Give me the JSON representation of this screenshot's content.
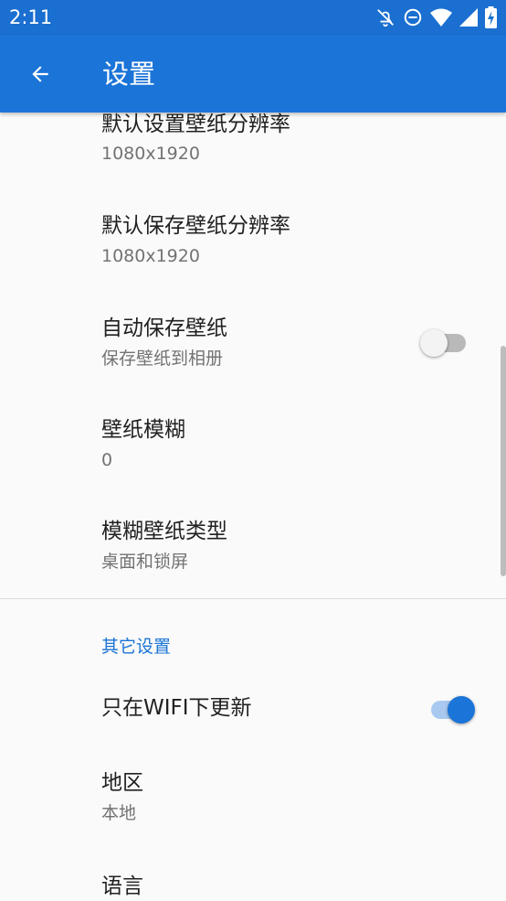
{
  "status_bar": {
    "time": "2:11",
    "icons": [
      "notifications-off-icon",
      "do-not-disturb-icon",
      "wifi-icon",
      "cell-signal-icon",
      "battery-charging-icon"
    ]
  },
  "app_bar": {
    "title": "设置",
    "back_icon": "arrow-back-icon",
    "color": "#1b74d8"
  },
  "settings": {
    "default_wallpaper_resolution": {
      "title": "默认设置壁纸分辨率",
      "value": "1080x1920"
    },
    "default_save_resolution": {
      "title": "默认保存壁纸分辨率",
      "value": "1080x1920"
    },
    "auto_save": {
      "title": "自动保存壁纸",
      "summary": "保存壁纸到相册",
      "enabled": false
    },
    "blur": {
      "title": "壁纸模糊",
      "value": "0"
    },
    "blur_type": {
      "title": "模糊壁纸类型",
      "value": "桌面和锁屏"
    }
  },
  "other_settings": {
    "header": "其它设置",
    "wifi_only": {
      "title": "只在WIFI下更新",
      "enabled": true
    },
    "region": {
      "title": "地区",
      "value": "本地"
    },
    "language": {
      "title": "语言"
    }
  },
  "colors": {
    "accent": "#1b74d8",
    "section_header": "#1a74d6",
    "background": "#fafafa"
  }
}
